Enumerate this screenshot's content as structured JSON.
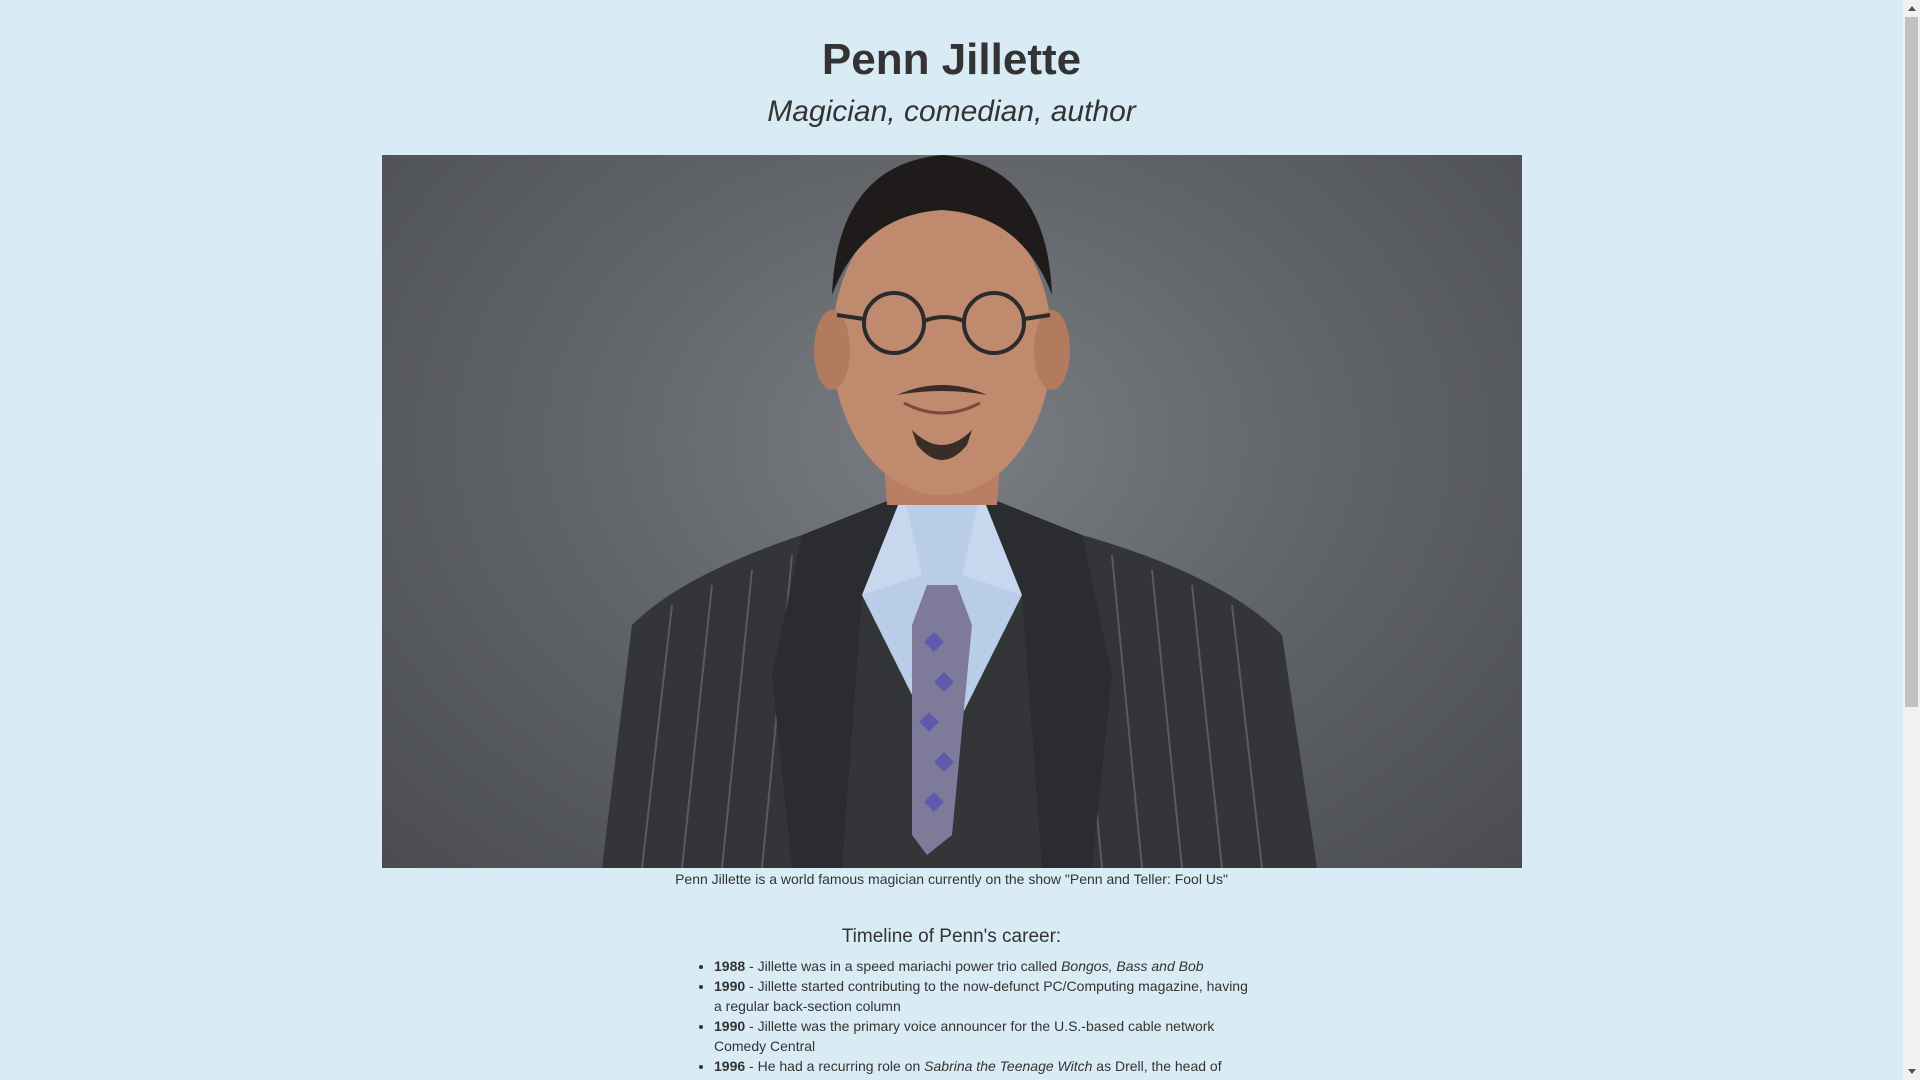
{
  "header": {
    "title": "Penn Jillette",
    "subtitle": "Magician, comedian, author"
  },
  "photo": {
    "caption": "Penn Jillette is a world famous magician currently on the show \"Penn and Teller: Fool Us\""
  },
  "timeline": {
    "heading": "Timeline of Penn's career:",
    "items": [
      {
        "year": "1988",
        "sep": " - ",
        "text": "Jillette was in a speed mariachi power trio called ",
        "em": "Bongos, Bass and Bob",
        "tail": ""
      },
      {
        "year": "1990",
        "sep": " - ",
        "text": "Jillette started contributing to the now-defunct PC/Computing magazine, having a regular back-section column",
        "em": "",
        "tail": ""
      },
      {
        "year": "1990",
        "sep": " - ",
        "text": "Jillette was the primary voice announcer for the U.S.-based cable network Comedy Central",
        "em": "",
        "tail": ""
      },
      {
        "year": "1996",
        "sep": " - ",
        "text": "He had a recurring role on ",
        "em": "Sabrina the Teenage Witch",
        "tail": " as Drell, the head of"
      }
    ]
  },
  "scrollbar": {
    "position": 0
  },
  "colors": {
    "background": "#d9ecf5",
    "text": "#333333"
  }
}
